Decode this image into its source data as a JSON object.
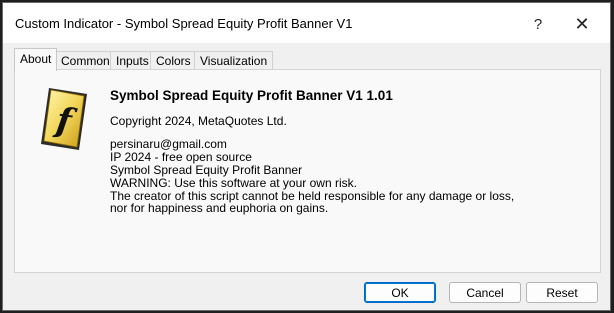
{
  "window": {
    "title": "Custom Indicator - Symbol Spread Equity Profit Banner V1",
    "help_symbol": "?",
    "close_symbol": "✕"
  },
  "tabs": [
    {
      "label": "About",
      "active": true
    },
    {
      "label": "Common",
      "active": false
    },
    {
      "label": "Inputs",
      "active": false
    },
    {
      "label": "Colors",
      "active": false
    },
    {
      "label": "Visualization",
      "active": false
    }
  ],
  "about": {
    "logo_icon": "function-f-icon",
    "logo_letter": "f",
    "heading": "Symbol Spread Equity Profit Banner V1 1.01",
    "copyright": "Copyright 2024, MetaQuotes Ltd.",
    "description": [
      "persinaru@gmail.com",
      "IP 2024 - free open source",
      "Symbol Spread Equity Profit Banner",
      "WARNING: Use this software at your own risk.",
      "The creator of this script cannot be held responsible for any damage or loss,",
      "nor for happiness and euphoria on gains."
    ]
  },
  "buttons": {
    "ok": "OK",
    "cancel": "Cancel",
    "reset": "Reset"
  }
}
